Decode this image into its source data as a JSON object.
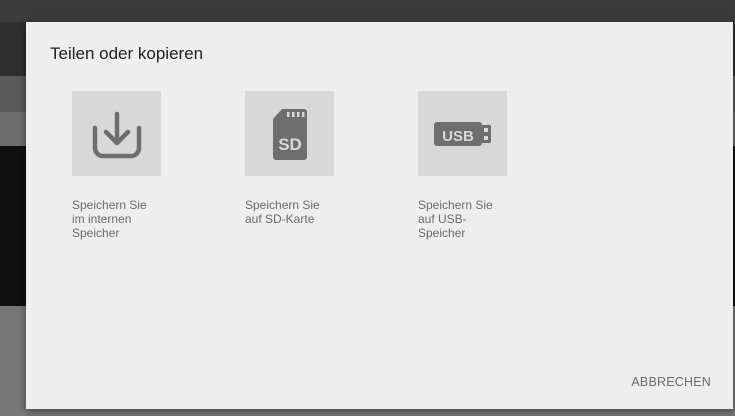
{
  "dialog": {
    "title": "Teilen oder kopieren",
    "options": [
      {
        "icon": "download-icon",
        "label_lines": [
          "Speichern Sie",
          "im internen",
          "Speicher"
        ]
      },
      {
        "icon": "sd-card-icon",
        "icon_text": "SD",
        "label_lines": [
          "Speichern Sie",
          "auf SD-Karte"
        ]
      },
      {
        "icon": "usb-icon",
        "icon_text": "USB",
        "label_lines": [
          "Speichern Sie",
          "auf USB-",
          "Speicher"
        ]
      }
    ],
    "cancel_label": "ABBRECHEN"
  },
  "colors": {
    "dialog_background": "#eeeeee",
    "tile_background": "#d8d8d8",
    "icon": "#6e6e6e",
    "label_text": "#6b6b6b",
    "title_text": "#222222"
  }
}
